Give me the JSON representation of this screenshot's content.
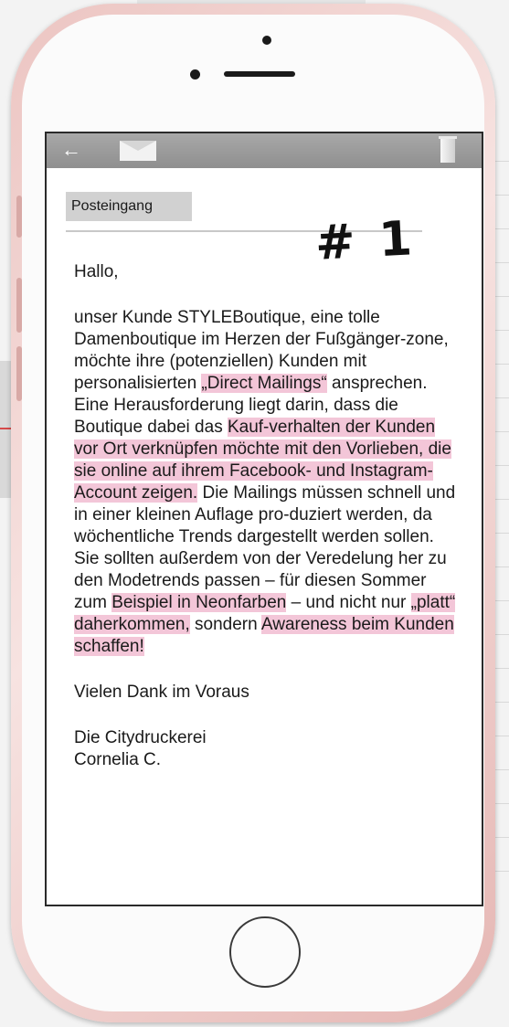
{
  "toolbar": {
    "back_icon": "←",
    "mail_icon": "mail-icon",
    "trash_icon": "trash-icon"
  },
  "inbox_tab": {
    "label": "Posteingang"
  },
  "handwritten_note": "# 1",
  "email": {
    "greeting": "Hallo,",
    "body_parts": [
      "unser Kunde STYLEBoutique, eine tolle Damenboutique im Herzen der Fußgänger-zone, möchte ihre (potenziellen) Kunden mit personalisierten ",
      "„Direct Mailings“",
      " ansprechen. Eine Herausforderung liegt darin, dass die Boutique dabei das ",
      "Kauf-verhalten der Kunden vor Ort verknüpfen möchte mit den Vorlieben, die sie online auf ihrem Facebook- und Instagram-Account zeigen.",
      " Die Mailings müssen schnell und in einer kleinen Auflage pro-duziert werden, da wöchentliche Trends dargestellt werden sollen. Sie sollten außerdem von der Veredelung her zu den Modetrends passen – für diesen Sommer zum ",
      "Beispiel in Neonfarben",
      " – und nicht nur ",
      "„platt“ daherkommen,",
      " sondern ",
      "Awareness beim Kunden schaffen!"
    ],
    "closing": "Vielen Dank im Voraus",
    "signature_company": "Die Citydruckerei",
    "signature_name": "Cornelia C."
  },
  "colors": {
    "highlight": "#f3c6d8",
    "toolbar": "#999999",
    "phone_frame": "#ecc5c2"
  }
}
